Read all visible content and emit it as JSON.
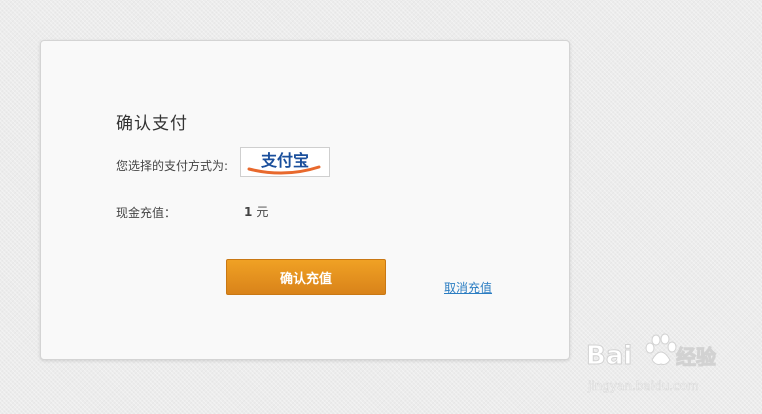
{
  "dialog": {
    "title": "确认支付",
    "payment_method_label": "您选择的支付方式为:",
    "payment_logo": {
      "name": "alipay-logo",
      "text": "支付宝",
      "color": "#1a4f9c",
      "accent": "#e8692d"
    },
    "amount_label": "现金充值：",
    "amount_value": "1",
    "amount_unit": "元",
    "confirm_label": "确认充值",
    "cancel_label": "取消充值"
  },
  "colors": {
    "button": "#e8951f",
    "link": "#2b7dc2",
    "card_bg": "#f9f9f9"
  },
  "watermark": {
    "text_main": "Bai",
    "text_sub": "经验",
    "url": "jingyan.baidu.com"
  }
}
